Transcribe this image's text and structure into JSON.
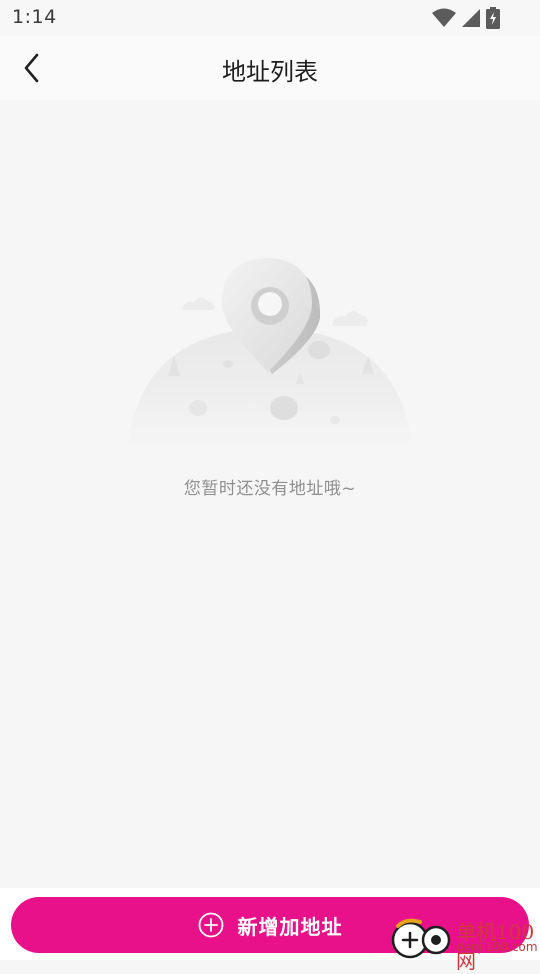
{
  "status_bar": {
    "time": "1:14",
    "icons": [
      "wifi-icon",
      "signal-icon",
      "battery-icon"
    ]
  },
  "header": {
    "back_icon": "chevron-left-icon",
    "title": "地址列表"
  },
  "empty_state": {
    "illustration_icon": "location-pin-illustration",
    "message": "您暂时还没有地址哦~"
  },
  "footer": {
    "add_button_icon": "plus-circle-icon",
    "add_button_label": "新增加地址"
  },
  "watermark": {
    "text": "单机100网",
    "domain": "danji100.com"
  },
  "colors": {
    "accent": "#e8118a",
    "background": "#f6f6f6",
    "text_muted": "#8f8f8f",
    "watermark": "#d1383a"
  }
}
